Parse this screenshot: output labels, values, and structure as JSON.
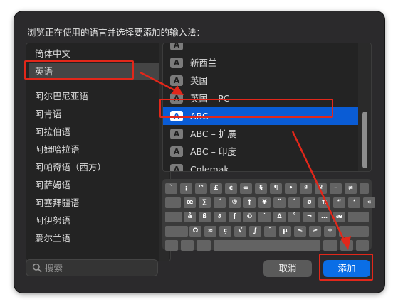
{
  "dialog": {
    "prompt": "浏览正在使用的语言并选择要添加的输入法："
  },
  "languages": {
    "items": [
      {
        "label": "简体中文"
      },
      {
        "label": "英语",
        "selected": true
      },
      {
        "label": "阿尔巴尼亚语"
      },
      {
        "label": "阿肯语"
      },
      {
        "label": "阿拉伯语"
      },
      {
        "label": "阿姆哈拉语"
      },
      {
        "label": "阿帕奇语（西方）"
      },
      {
        "label": "阿萨姆语"
      },
      {
        "label": "阿塞拜疆语"
      },
      {
        "label": "阿伊努语"
      },
      {
        "label": "爱尔兰语"
      }
    ]
  },
  "input_sources": {
    "badge": "A",
    "items": [
      {
        "label": "新西兰"
      },
      {
        "label": "英国"
      },
      {
        "label": "英国 – PC"
      },
      {
        "label": "ABC",
        "selected": true
      },
      {
        "label": "ABC – 扩展"
      },
      {
        "label": "ABC – 印度"
      },
      {
        "label": "Colemak"
      }
    ]
  },
  "keyboard": {
    "rows": [
      [
        "`",
        "¡",
        "™",
        "£",
        "¢",
        "∞",
        "§",
        "¶",
        "•",
        "ª",
        "º",
        "–",
        "≠"
      ],
      [
        "œ",
        "∑",
        "´",
        "®",
        "†",
        "¥",
        "¨",
        "ˆ",
        "ø",
        "π",
        "“",
        "‘",
        "«"
      ],
      [
        "å",
        "ß",
        "∂",
        "ƒ",
        "©",
        "˙",
        "∆",
        "˚",
        "¬",
        "…",
        "æ"
      ],
      [
        "Ω",
        "≈",
        "ç",
        "√",
        "∫",
        "˜",
        "µ",
        "≤",
        "≥",
        "÷"
      ]
    ]
  },
  "search": {
    "placeholder": "搜索"
  },
  "buttons": {
    "cancel": "取消",
    "add": "添加"
  },
  "colors": {
    "accent": "#0a6ee6",
    "selection": "#0a5cd5",
    "annotation": "#e2271a"
  }
}
